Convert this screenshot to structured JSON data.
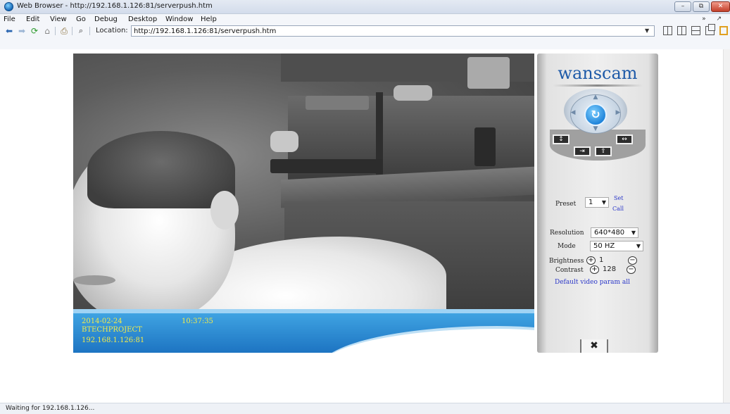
{
  "window": {
    "title": "Web Browser - http://192.168.1.126:81/serverpush.htm",
    "minimize": "–",
    "maximize": "⧉",
    "close": "✕"
  },
  "menu": {
    "items": [
      "File",
      "Edit",
      "View",
      "Go",
      "Debug",
      "Desktop",
      "Window",
      "Help"
    ],
    "corner": "» ↗"
  },
  "toolbar": {
    "location_label": "Location:",
    "location_value": "http://192.168.1.126:81/serverpush.htm"
  },
  "osd": {
    "date": "2014-02-24",
    "time": "10:37:35",
    "camera_name": "BTECHPROJECT",
    "ip": "192.168.1.126:81"
  },
  "panel": {
    "brand": "wanscam",
    "preset_label": "Preset",
    "preset_value": "1",
    "set_link": "Set",
    "call_link": "Call",
    "resolution_label": "Resolution",
    "resolution_value": "640*480",
    "mode_label": "Mode",
    "mode_value": "50 HZ",
    "brightness_label": "Brightness",
    "brightness_value": "1",
    "contrast_label": "Contrast",
    "contrast_value": "128",
    "default_link": "Default video param all"
  },
  "status": {
    "text": "Waiting for 192.168.1.126..."
  },
  "colors": {
    "brand": "#1e5aa8",
    "osd_text": "#f2ea4a",
    "osd_bar": "#1d74c2",
    "link": "#2a36c8"
  },
  "icons": {
    "app": "browser-globe-icon",
    "back": "arrow-left-icon",
    "forward": "arrow-right-icon",
    "refresh": "refresh-icon",
    "home": "home-icon",
    "print": "print-icon",
    "find": "binoculars-icon",
    "ptz_center": "center-rotate-icon",
    "settings": "tools-icon"
  }
}
